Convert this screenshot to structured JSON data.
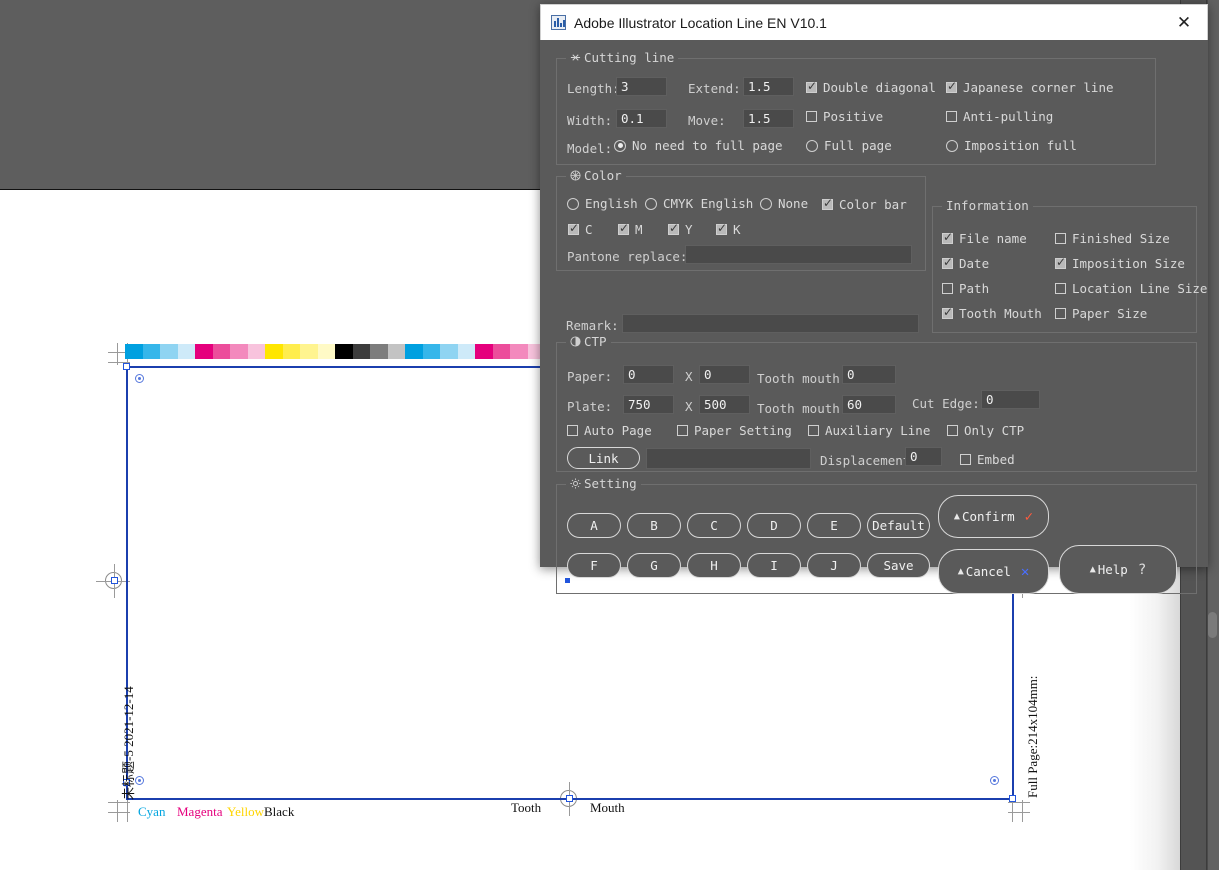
{
  "window": {
    "title": "Adobe Illustrator Location Line EN V10.1",
    "close_label": "✕",
    "icon": "app-icon"
  },
  "cutting_line": {
    "legend": "Cutting line",
    "legend_icon": "scissors-icon",
    "length_label": "Length:",
    "length_value": "3",
    "width_label": "Width:",
    "width_value": "0.1",
    "model_label": "Model:",
    "extend_label": "Extend:",
    "extend_value": "1.5",
    "move_label": "Move:",
    "move_value": "1.5",
    "double_diagonal": "Double diagonal",
    "double_diagonal_checked": true,
    "positive": "Positive",
    "positive_checked": false,
    "japanese_corner_line": "Japanese corner line",
    "japanese_corner_line_checked": true,
    "anti_pulling": "Anti-pulling",
    "anti_pulling_checked": false,
    "no_need_full_page": "No need to full page",
    "full_page": "Full page",
    "imposition_full": "Imposition full",
    "model_selected": "No need to full page"
  },
  "color": {
    "legend": "Color",
    "legend_icon": "color-wheel-icon",
    "english": "English",
    "english_checked": false,
    "cmyk_english": "CMYK English",
    "cmyk_english_checked": false,
    "none": "None",
    "none_checked": false,
    "color_bar": "Color bar",
    "color_bar_checked": true,
    "c": "C",
    "c_checked": true,
    "m": "M",
    "m_checked": true,
    "y": "Y",
    "y_checked": true,
    "k": "K",
    "k_checked": true,
    "pantone_replace_label": "Pantone replace:",
    "pantone_replace_value": ""
  },
  "remark": {
    "label": "Remark:",
    "value": ""
  },
  "information": {
    "legend": "Information",
    "items": [
      {
        "label": "File name",
        "checked": true
      },
      {
        "label": "Finished Size",
        "checked": false
      },
      {
        "label": "Date",
        "checked": true
      },
      {
        "label": "Imposition Size",
        "checked": true
      },
      {
        "label": "Path",
        "checked": false
      },
      {
        "label": "Location Line Size",
        "checked": false
      },
      {
        "label": "Tooth Mouth",
        "checked": true
      },
      {
        "label": "Paper Size",
        "checked": false
      }
    ]
  },
  "ctp": {
    "legend": "CTP",
    "legend_icon": "ctp-icon",
    "paper_label": "Paper:",
    "paper_w": "0",
    "paper_x": "X",
    "paper_h": "0",
    "paper_tooth_label": "Tooth mouth:",
    "paper_tooth": "0",
    "plate_label": "Plate:",
    "plate_w": "750",
    "plate_x": "X",
    "plate_h": "500",
    "plate_tooth_label": "Tooth mouth:",
    "plate_tooth": "60",
    "cut_edge_label": "Cut Edge:",
    "cut_edge": "0",
    "auto_page": "Auto Page",
    "auto_page_checked": false,
    "paper_setting": "Paper Setting",
    "paper_setting_checked": false,
    "auxiliary_line": "Auxiliary Line",
    "auxiliary_line_checked": false,
    "only_ctp": "Only CTP",
    "only_ctp_checked": false,
    "link_label": "Link",
    "link_value": "",
    "displacement_label": "Displacement:",
    "displacement_value": "0",
    "embed": "Embed",
    "embed_checked": false
  },
  "setting": {
    "legend": "Setting",
    "legend_icon": "gear-icon",
    "row1": [
      "A",
      "B",
      "C",
      "D",
      "E"
    ],
    "default_label": "Default",
    "row2": [
      "F",
      "G",
      "H",
      "I",
      "J"
    ],
    "save_label": "Save",
    "confirm_label": "Confirm",
    "confirm_mark": "✓",
    "cancel_label": "Cancel",
    "cancel_mark": "✕",
    "help_label": "Help",
    "help_mark": "?",
    "triangle": "▲"
  },
  "artboard": {
    "doc_name_date": "未标题-5 2021-12-14",
    "page_size": "Full Page:214x104mm:",
    "tooth": "Tooth",
    "mouth": "Mouth",
    "color_labels": {
      "cyan": "Cyan",
      "magenta": "Magenta",
      "yellow": "Yellow",
      "black": "Black"
    },
    "colorbar_swatches": [
      "#00a0e0",
      "#35b6ea",
      "#8fd4f2",
      "#ceeaf9",
      "#e5007d",
      "#ec4d9b",
      "#f389bd",
      "#f8c3dd",
      "#ffe600",
      "#ffed4d",
      "#fff48f",
      "#fffac6",
      "#000000",
      "#3c3c3c",
      "#7d7d7d",
      "#c3c3c3",
      "#00a0e0",
      "#35b6ea",
      "#8fd4f2",
      "#ceeaf9",
      "#e5007d",
      "#ec4d9b",
      "#f389bd",
      "#f8c3dd",
      "#ffe600",
      "#ffed4d",
      "#fff48f",
      "#fffac6",
      "#000000",
      "#3c3c3c",
      "#7d7d7d",
      "#c3c3c3",
      "#00a0e0",
      "#35b6ea"
    ]
  }
}
